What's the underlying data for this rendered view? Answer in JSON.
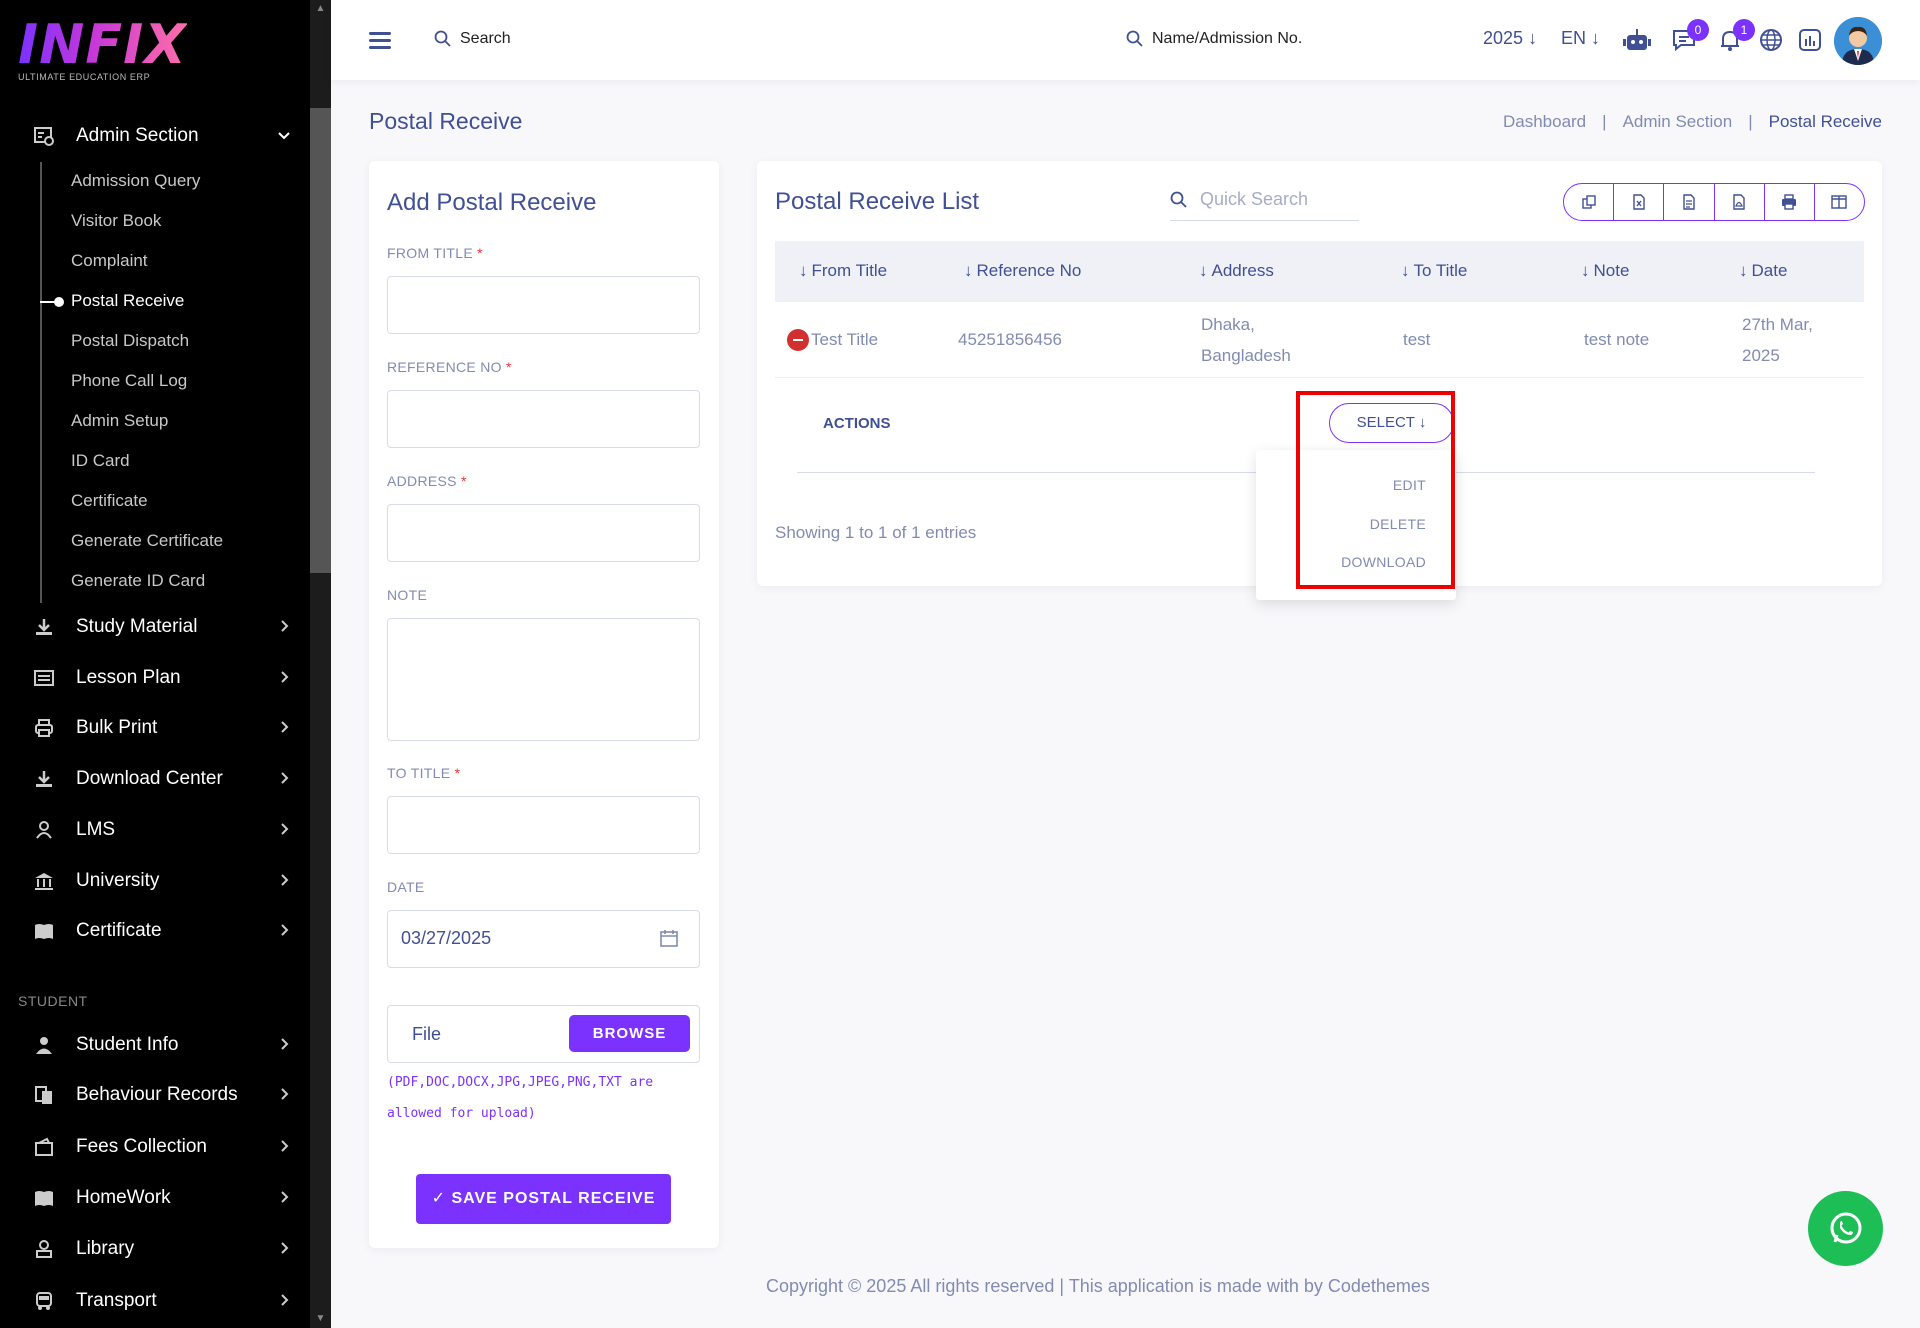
{
  "brand": {
    "name": "INFIX",
    "tagline": "ULTIMATE EDUCATION ERP"
  },
  "sidebar": {
    "admin_section": "Admin Section",
    "admin_sub": [
      "Admission Query",
      "Visitor Book",
      "Complaint",
      "Postal Receive",
      "Postal Dispatch",
      "Phone Call Log",
      "Admin Setup",
      "ID Card",
      "Certificate",
      "Generate Certificate",
      "Generate ID Card"
    ],
    "active_sub": "Postal Receive",
    "groups": [
      "Study Material",
      "Lesson Plan",
      "Bulk Print",
      "Download Center",
      "LMS",
      "University",
      "Certificate"
    ],
    "student_section_label": "STUDENT",
    "student_groups": [
      "Student Info",
      "Behaviour Records",
      "Fees Collection",
      "HomeWork",
      "Library",
      "Transport"
    ]
  },
  "header": {
    "search_label": "Search",
    "student_search_label": "Name/Admission No.",
    "year": "2025",
    "language": "EN",
    "chat_badge": "0",
    "notification_badge": "1"
  },
  "page": {
    "title": "Postal Receive",
    "breadcrumb": [
      "Dashboard",
      "Admin Section",
      "Postal Receive"
    ]
  },
  "form": {
    "title": "Add Postal Receive",
    "from_title_label": "FROM TITLE",
    "reference_no_label": "REFERENCE NO",
    "address_label": "ADDRESS",
    "note_label": "NOTE",
    "to_title_label": "TO TITLE",
    "date_label": "DATE",
    "date_value": "03/27/2025",
    "file_label": "File",
    "browse_label": "BROWSE",
    "file_hint": "(PDF,DOC,DOCX,JPG,JPEG,PNG,TXT are allowed for upload)",
    "save_label": "✓ SAVE POSTAL RECEIVE",
    "required_mark": "*"
  },
  "list": {
    "title": "Postal Receive List",
    "search_placeholder": "Quick Search",
    "columns": [
      "From Title",
      "Reference No",
      "Address",
      "To Title",
      "Note",
      "Date"
    ],
    "rows": [
      {
        "from_title": "Test Title",
        "reference_no": "45251856456",
        "address_line1": "Dhaka,",
        "address_line2": "Bangladesh",
        "to_title": "test",
        "note": "test note",
        "date_line1": "27th Mar,",
        "date_line2": "2025"
      }
    ],
    "actions_label": "ACTIONS",
    "select_label": "SELECT",
    "dropdown": [
      "EDIT",
      "DELETE",
      "DOWNLOAD"
    ],
    "showing": "Showing 1 to 1 of 1 entries"
  },
  "footer": "Copyright © 2025 All rights reserved | This application is made with by Codethemes",
  "colors": {
    "primary": "#7c32ff",
    "heading": "#415094",
    "muted": "#828bb2",
    "highlight": "#ee0000",
    "whatsapp": "#1ebe57"
  }
}
